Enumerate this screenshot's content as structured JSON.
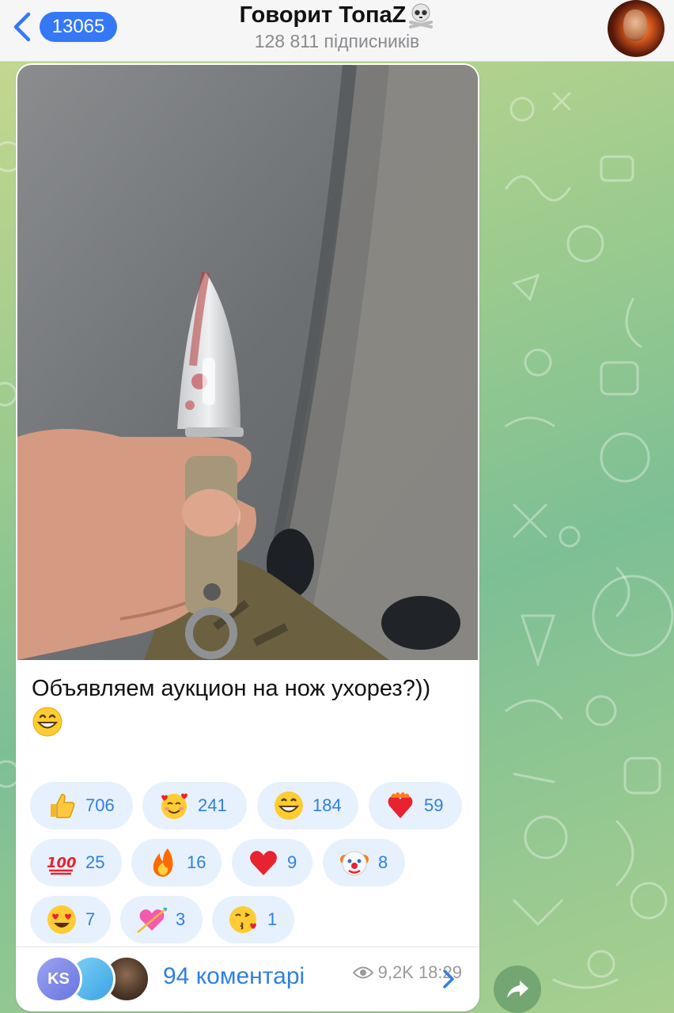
{
  "header": {
    "back_count": "13065",
    "title": "Говорит ТопаZ",
    "subscribers": "128 811 підписників"
  },
  "message": {
    "caption_text": "Объявляем аукцион на нож ухорез?))",
    "caption_emoji": "grinning-face",
    "reactions": [
      {
        "emoji": "thumbs-up",
        "count": "706"
      },
      {
        "emoji": "smiling-face-with-hearts",
        "count": "241"
      },
      {
        "emoji": "grinning-face",
        "count": "184"
      },
      {
        "emoji": "heart-on-fire",
        "count": "59"
      },
      {
        "emoji": "hundred-points",
        "count": "25"
      },
      {
        "emoji": "fire",
        "count": "16"
      },
      {
        "emoji": "red-heart",
        "count": "9"
      },
      {
        "emoji": "clown-face",
        "count": "8"
      },
      {
        "emoji": "heart-eyes",
        "count": "7"
      },
      {
        "emoji": "heart-with-arrow",
        "count": "3"
      },
      {
        "emoji": "face-blowing-kiss",
        "count": "1"
      }
    ],
    "views": "9,2K",
    "time": "18:29",
    "comments": {
      "avatar_initials": "KS",
      "label": "94 коментарі"
    }
  },
  "colors": {
    "accent": "#2f7fe0",
    "reaction_bg": "#e7f1fd",
    "back_badge": "#3478f6"
  }
}
